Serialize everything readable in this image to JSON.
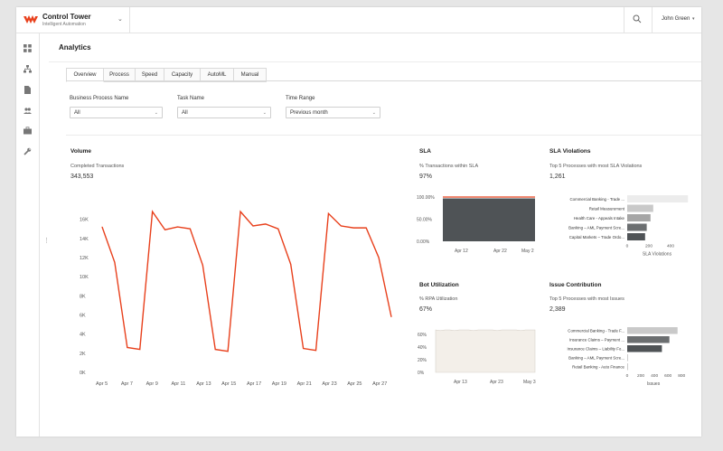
{
  "app": {
    "brand_title": "Control Tower",
    "brand_subtitle": "Intelligent Automation",
    "user_name": "John Green",
    "accent_color": "#e8401c",
    "chart_dark": "#4f5356"
  },
  "sidebar": {
    "icons": [
      "dashboard-icon",
      "process-tree-icon",
      "document-icon",
      "users-icon",
      "briefcase-icon",
      "wrench-icon"
    ]
  },
  "page": {
    "title": "Analytics"
  },
  "tabs": [
    {
      "label": "Overview",
      "active": true
    },
    {
      "label": "Process",
      "active": false
    },
    {
      "label": "Speed",
      "active": false
    },
    {
      "label": "Capacity",
      "active": false
    },
    {
      "label": "AutoML",
      "active": false
    },
    {
      "label": "Manual",
      "active": false
    }
  ],
  "filters": {
    "process": {
      "label": "Business Process Name",
      "value": "All"
    },
    "task": {
      "label": "Task Name",
      "value": "All"
    },
    "range": {
      "label": "Time Range",
      "value": "Previous month"
    }
  },
  "volume": {
    "title": "Volume",
    "metric_label": "Completed Transactions",
    "metric_value": "343,553"
  },
  "sla": {
    "title": "SLA",
    "metric_label": "% Transactions within SLA",
    "metric_value": "97%"
  },
  "sla_violations": {
    "title": "SLA Violations",
    "metric_label": "Top 5 Processes with most SLA Violations",
    "metric_value": "1,261"
  },
  "bot": {
    "title": "Bot Utilization",
    "metric_label": "% RPA Utilization",
    "metric_value": "67%"
  },
  "issues": {
    "title": "Issue Contribution",
    "metric_label": "Top 5 Processes with most Issues",
    "metric_value": "2,389"
  },
  "chart_data": [
    {
      "id": "volume",
      "type": "line",
      "x": [
        "Apr 5",
        "",
        "Apr 7",
        "",
        "Apr 9",
        "",
        "Apr 11",
        "",
        "Apr 13",
        "",
        "Apr 15",
        "",
        "Apr 17",
        "",
        "Apr 19",
        "",
        "Apr 21",
        "",
        "Apr 23",
        "",
        "Apr 25",
        "",
        "Apr 27",
        ""
      ],
      "xticks": [
        "Apr 5",
        "Apr 7",
        "Apr 9",
        "Apr 11",
        "Apr 13",
        "Apr 15",
        "Apr 17",
        "Apr 19",
        "Apr 21",
        "Apr 23",
        "Apr 25",
        "Apr 27"
      ],
      "yticks": [
        "0K",
        "2K",
        "4K",
        "6K",
        "8K",
        "10K",
        "12K",
        "14K",
        "16K"
      ],
      "series": [
        {
          "values": [
            15200,
            11500,
            2600,
            2400,
            16800,
            14900,
            15200,
            15000,
            11200,
            2400,
            2200,
            16800,
            15300,
            15500,
            15000,
            11300,
            2500,
            2300,
            16600,
            15300,
            15100,
            15100,
            12000,
            5800
          ]
        }
      ],
      "ylim": [
        0,
        17000
      ],
      "color": "#e8401c"
    },
    {
      "id": "sla",
      "type": "area",
      "xticks": [
        "Apr 12",
        "Apr 22",
        "May 2"
      ],
      "yticks": [
        "100.00%",
        "50.00%",
        "0.00%"
      ],
      "series": [
        {
          "values": [
            97,
            97,
            97,
            97,
            97,
            97,
            97,
            97,
            97,
            97,
            97,
            97,
            97,
            97,
            97,
            97,
            97,
            97,
            97,
            97,
            97,
            97
          ]
        }
      ],
      "ylim": [
        0,
        100
      ],
      "target": 100
    },
    {
      "id": "sla_violations",
      "type": "bar",
      "orientation": "horizontal",
      "categories": [
        "Commercial Banking - Trade ...",
        "Retail Measurement",
        "Health Care - Appeals Intake",
        "Banking – AML Payment Scre...",
        "Capital Markets – Trade Ordo..."
      ],
      "values": [
        560,
        240,
        215,
        180,
        165
      ],
      "xticks": [
        "0",
        "200",
        "400"
      ],
      "xlim": [
        0,
        600
      ],
      "xlabel": "SLA Violations"
    },
    {
      "id": "bot",
      "type": "area",
      "xticks": [
        "Apr 13",
        "Apr 23",
        "May 3"
      ],
      "yticks": [
        "60%",
        "40%",
        "20%",
        "0%"
      ],
      "series": [
        {
          "values": [
            67,
            66,
            67,
            67,
            66,
            67,
            67,
            67,
            66,
            67,
            67,
            67,
            67,
            66,
            67,
            67,
            67,
            67,
            66,
            67,
            67,
            67
          ]
        }
      ],
      "ylim": [
        0,
        70
      ]
    },
    {
      "id": "issues",
      "type": "bar",
      "orientation": "horizontal",
      "categories": [
        "Commercial Banking - Trade F...",
        "Insurance Claims – Payment ...",
        "Insurance Claims – Liability Fo...",
        "Banking – AML Payment Scre...",
        "Retail Banking - Auto Finance"
      ],
      "values": [
        740,
        620,
        510,
        10,
        10
      ],
      "xticks": [
        "0",
        "200",
        "400",
        "600",
        "800"
      ],
      "xlim": [
        0,
        850
      ],
      "xlabel": "Issues"
    }
  ]
}
